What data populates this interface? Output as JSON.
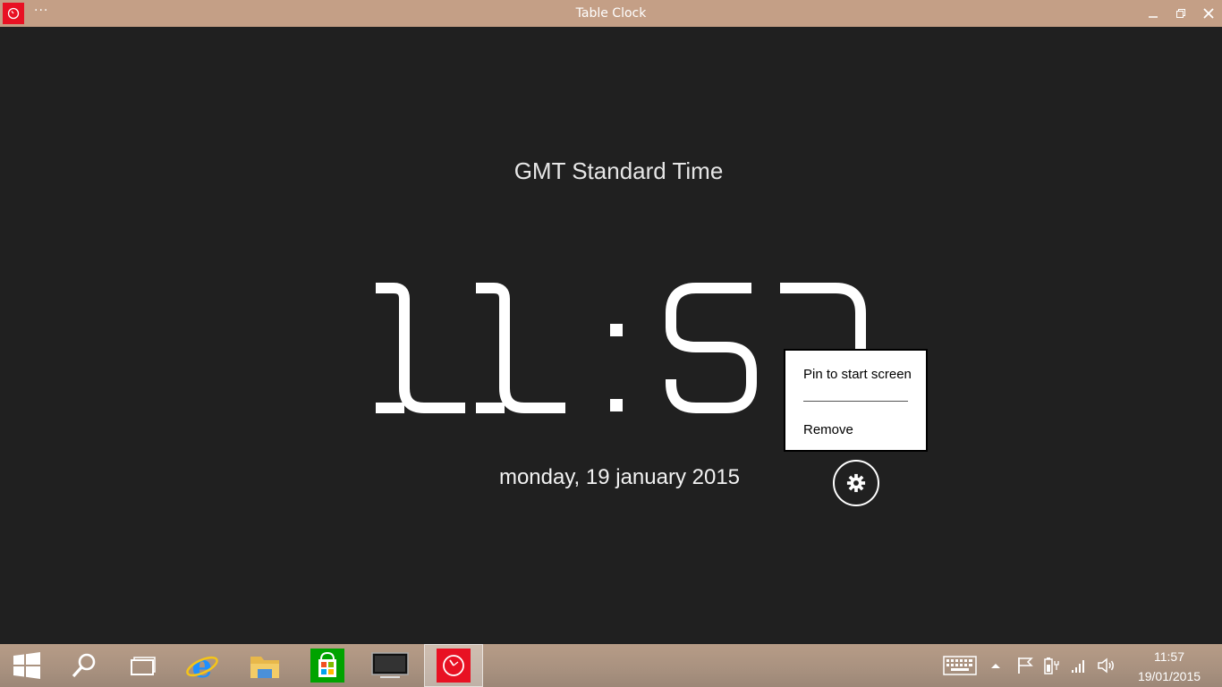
{
  "window": {
    "title": "Table Clock",
    "menu_label": "···",
    "minimize_label": "–",
    "close_label": "✕"
  },
  "clock": {
    "timezone": "GMT Standard Time",
    "time_digits": [
      "1",
      "1",
      ":",
      "5",
      "7"
    ],
    "date": "monday, 19 january 2015"
  },
  "context_menu": {
    "pin_label": "Pin to start screen",
    "remove_label": "Remove"
  },
  "taskbar": {
    "apps": [
      "start-icon",
      "search-icon",
      "task-view-icon",
      "internet-explorer-icon",
      "file-explorer-icon",
      "store-icon",
      "desktop-icon",
      "table-clock-icon"
    ],
    "tray": {
      "time": "11:57",
      "date": "19/01/2015"
    }
  },
  "colors": {
    "titlebar": "#c49f86",
    "background": "#202020",
    "accent": "#e81123"
  }
}
